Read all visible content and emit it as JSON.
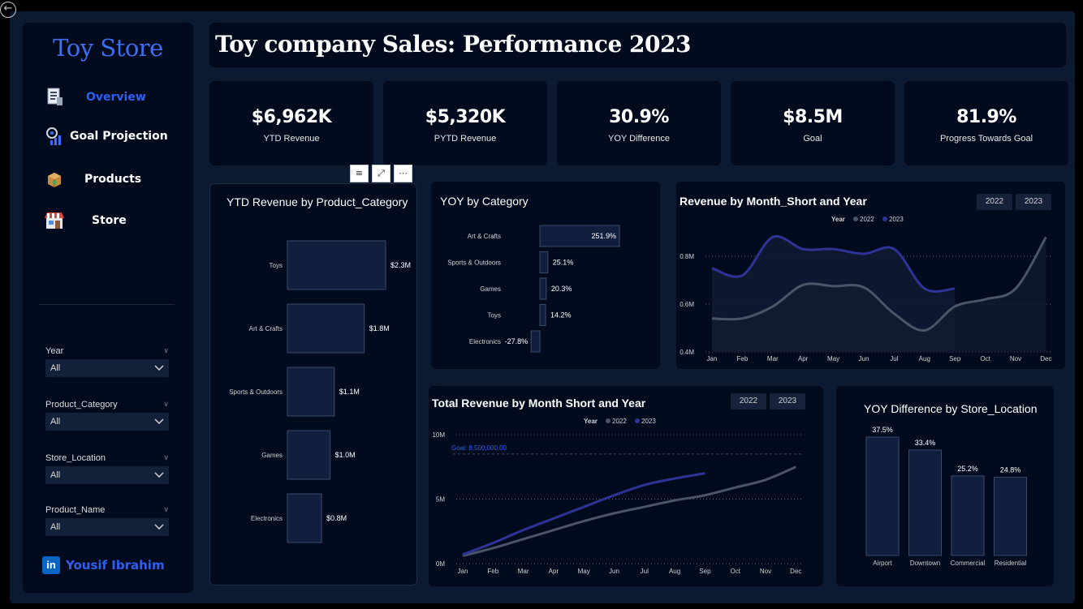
{
  "sidebar": {
    "brand": "Toy Store",
    "nav": [
      {
        "label": "Overview",
        "icon": "report-icon"
      },
      {
        "label": "Goal Projection",
        "icon": "target-chart-icon"
      },
      {
        "label": "Products",
        "icon": "box-icon"
      },
      {
        "label": "Store",
        "icon": "storefront-icon"
      }
    ],
    "filters": [
      {
        "label": "Year",
        "value": "All"
      },
      {
        "label": "Product_Category",
        "value": "All"
      },
      {
        "label": "Store_Location",
        "value": "All"
      },
      {
        "label": "Product_Name",
        "value": "All"
      }
    ],
    "author": "Yousif Ibrahim",
    "author_icon": "linkedin-icon"
  },
  "header": {
    "title": "Toy company Sales: Performance 2023"
  },
  "kpis": [
    {
      "value": "$6,962K",
      "label": "YTD Revenue"
    },
    {
      "value": "$5,320K",
      "label": "PYTD Revenue"
    },
    {
      "value": "30.9%",
      "label": "YOY Difference"
    },
    {
      "value": "$8.5M",
      "label": "Goal"
    },
    {
      "value": "81.9%",
      "label": "Progress Towards Goal"
    }
  ],
  "colors": {
    "bar_fill": "#0f1f3d",
    "bar_stroke": "#3a4a66",
    "series_2022": "#4a5568",
    "series_2023": "#2e3497",
    "goal_line": "#2f5ff0",
    "accent": "#2f5ff0"
  },
  "chart_data": [
    {
      "type": "bar",
      "orientation": "horizontal",
      "title": "YTD Revenue by Product_Category",
      "categories": [
        "Toys",
        "Art & Crafts",
        "Sports & Outdoors",
        "Games",
        "Electronics"
      ],
      "values": [
        2.3,
        1.8,
        1.1,
        1.0,
        0.8
      ],
      "data_labels": [
        "$2.3M",
        "$1.8M",
        "$1.1M",
        "$1.0M",
        "$0.8M"
      ]
    },
    {
      "type": "bar",
      "orientation": "horizontal",
      "title": "YOY by Category",
      "categories": [
        "Art & Crafts",
        "Sports & Outdoors",
        "Games",
        "Toys",
        "Electronics"
      ],
      "values": [
        251.9,
        25.1,
        20.3,
        14.2,
        -27.8
      ],
      "data_labels": [
        "251.9%",
        "25.1%",
        "20.3%",
        "14.2%",
        "-27.8%"
      ]
    },
    {
      "type": "line",
      "title": "Revenue by Month_Short and Year",
      "legend_title": "Year",
      "legend_position": "top",
      "slicer": [
        "2022",
        "2023"
      ],
      "x": [
        "Jan",
        "Feb",
        "Mar",
        "Apr",
        "May",
        "Jun",
        "Jul",
        "Aug",
        "Sep",
        "Oct",
        "Nov",
        "Dec"
      ],
      "y_ticks": [
        "0.4M",
        "0.6M",
        "0.8M"
      ],
      "ylim": [
        0.4,
        0.9
      ],
      "series": [
        {
          "name": "2022",
          "values": [
            0.54,
            0.54,
            0.59,
            0.68,
            0.675,
            0.67,
            0.56,
            0.49,
            0.59,
            0.62,
            0.665,
            0.88
          ]
        },
        {
          "name": "2023",
          "values": [
            0.75,
            0.72,
            0.88,
            0.83,
            0.83,
            0.81,
            0.83,
            0.665,
            0.665
          ]
        }
      ]
    },
    {
      "type": "line",
      "title": "Total Revenue by Month Short and Year",
      "legend_title": "Year",
      "legend_position": "top",
      "slicer": [
        "2022",
        "2023"
      ],
      "x": [
        "Jan",
        "Feb",
        "Mar",
        "Apr",
        "May",
        "Jun",
        "Jul",
        "Aug",
        "Sep",
        "Oct",
        "Nov",
        "Dec"
      ],
      "y_ticks": [
        "0M",
        "5M",
        "10M"
      ],
      "ylim": [
        0,
        10
      ],
      "goal_label": "Goal: 8,500,000.00",
      "goal_value": 8.5,
      "series": [
        {
          "name": "2022",
          "values": [
            0.6,
            1.2,
            1.9,
            2.6,
            3.3,
            3.9,
            4.4,
            4.9,
            5.3,
            5.9,
            6.5,
            7.5
          ]
        },
        {
          "name": "2023",
          "values": [
            0.7,
            1.6,
            2.6,
            3.5,
            4.4,
            5.3,
            6.1,
            6.6,
            7.0
          ]
        }
      ]
    },
    {
      "type": "bar",
      "orientation": "vertical",
      "title": "YOY Difference by Store_Location",
      "categories": [
        "Airport",
        "Downtown",
        "Commercial",
        "Residential"
      ],
      "values": [
        37.5,
        33.4,
        25.2,
        24.8
      ],
      "data_labels": [
        "37.5%",
        "33.4%",
        "25.2%",
        "24.8%"
      ]
    }
  ]
}
